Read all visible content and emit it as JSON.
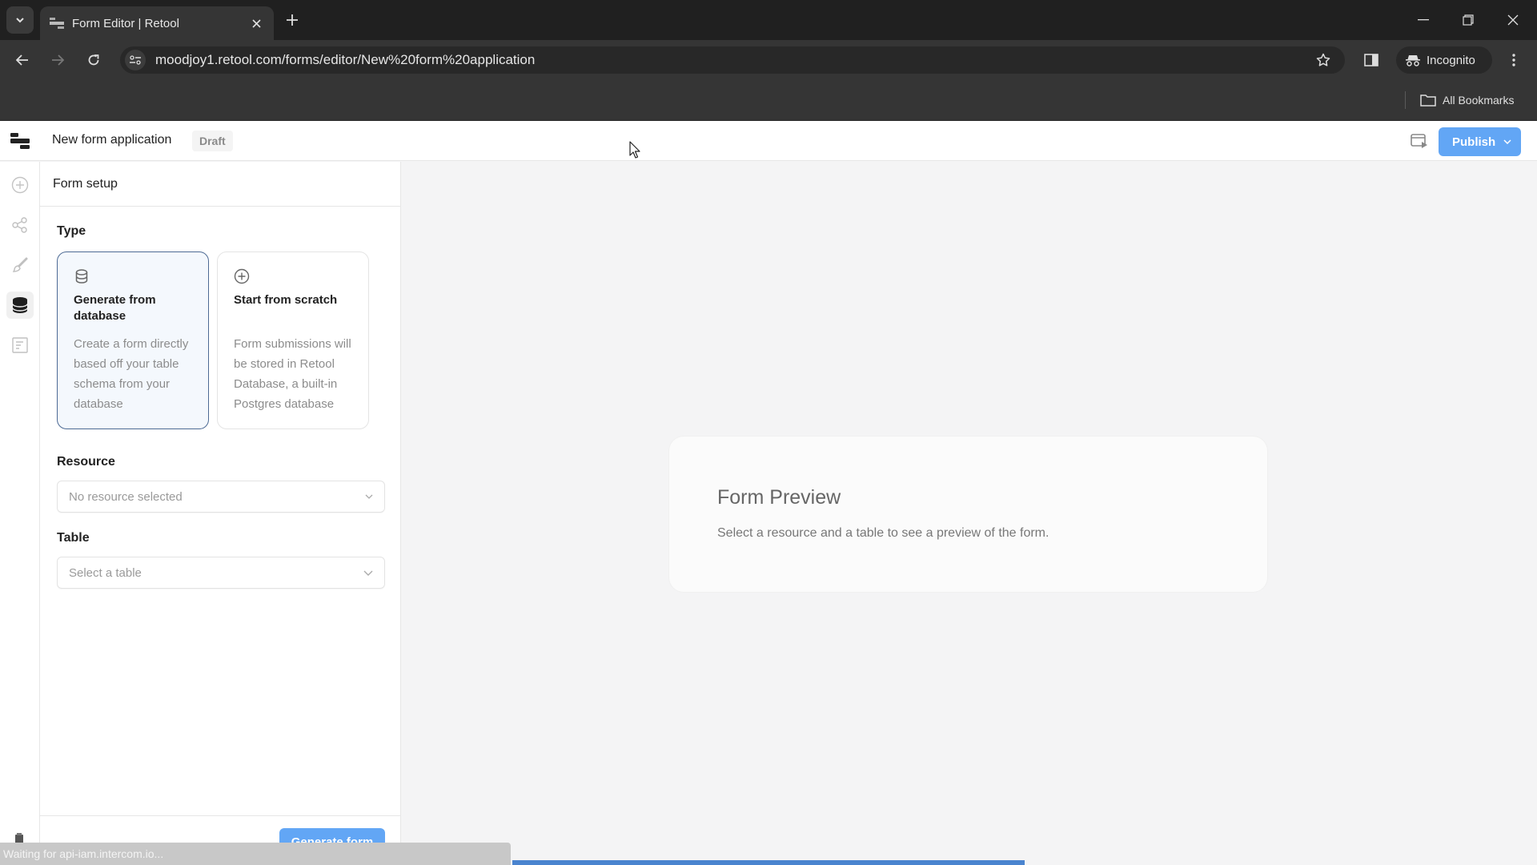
{
  "browser": {
    "tab_title": "Form Editor | Retool",
    "url": "moodjoy1.retool.com/forms/editor/New%20form%20application",
    "incognito_label": "Incognito",
    "bookmarks_label": "All Bookmarks",
    "status_text": "Waiting for api-iam.intercom.io...",
    "loading_progress": 0.5
  },
  "header": {
    "app_name": "New form application",
    "status_badge": "Draft",
    "publish_label": "Publish"
  },
  "rail": {
    "items": [
      {
        "name": "add",
        "icon": "plus-circle-icon",
        "active": false
      },
      {
        "name": "share",
        "icon": "share-icon",
        "active": false
      },
      {
        "name": "style",
        "icon": "brush-icon",
        "active": false
      },
      {
        "name": "database",
        "icon": "database-icon",
        "active": true
      },
      {
        "name": "form",
        "icon": "form-icon",
        "active": false
      }
    ]
  },
  "panel": {
    "title": "Form setup",
    "type_label": "Type",
    "type_options": [
      {
        "title": "Generate from database",
        "description": "Create a form directly based off your table schema from your database",
        "icon": "database-icon",
        "selected": true
      },
      {
        "title": "Start from scratch",
        "description": "Form submissions will be stored in Retool Database, a built-in Postgres database",
        "icon": "plus-circle-icon",
        "selected": false
      }
    ],
    "resource_label": "Resource",
    "resource_placeholder": "No resource selected",
    "table_label": "Table",
    "table_placeholder": "Select a table",
    "generate_label": "Generate form"
  },
  "preview": {
    "title": "Form Preview",
    "description": "Select a resource and a table to see a preview of the form."
  },
  "colors": {
    "accent": "#62a6f5",
    "selected_border": "#4d6a94",
    "selected_bg": "#f4f8fd"
  }
}
